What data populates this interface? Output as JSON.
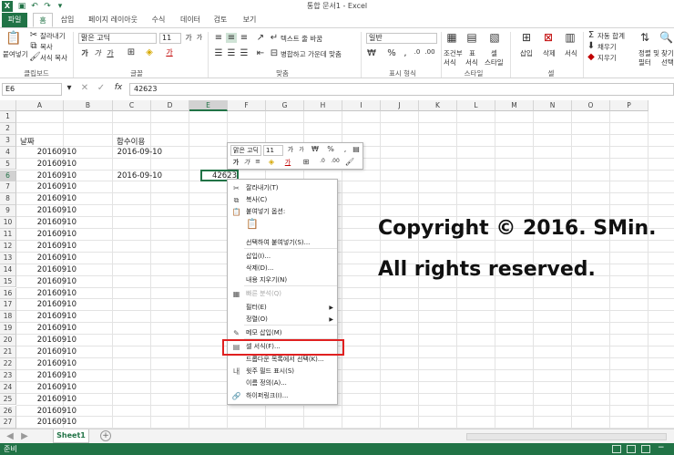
{
  "window": {
    "title": "통합 문서1 - Excel"
  },
  "ribbon_tabs": [
    "파일",
    "홈",
    "삽입",
    "페이지 레이아웃",
    "수식",
    "데이터",
    "검토",
    "보기"
  ],
  "ribbon": {
    "clipboard": {
      "paste": "붙여넣기",
      "cut": "잘라내기",
      "copy": "복사",
      "format_painter": "서식 복사",
      "label": "클립보드"
    },
    "font": {
      "name": "맑은 고딕",
      "size": "11",
      "label": "글꼴"
    },
    "alignment": {
      "wrap": "텍스트 줄 바꿈",
      "merge": "병합하고 가운데 맞춤",
      "label": "맞춤"
    },
    "number": {
      "format": "일반",
      "label": "표시 형식"
    },
    "styles": {
      "conditional": "조건부",
      "conditional2": "서식",
      "table": "표",
      "table2": "서식",
      "cell": "셀",
      "cell2": "스타일",
      "label": "스타일"
    },
    "cells": {
      "insert": "삽입",
      "delete": "삭제",
      "format": "서식",
      "label": "셀"
    },
    "editing": {
      "autosum": "자동 합계",
      "fill": "채우기",
      "clear": "지우기",
      "sort": "정렬 및",
      "sort2": "필터",
      "find": "찾기",
      "find2": "선택"
    }
  },
  "formula_bar": {
    "name_box": "E6",
    "formula": "42623"
  },
  "columns": [
    "A",
    "B",
    "C",
    "D",
    "E",
    "F",
    "G",
    "H",
    "I",
    "J",
    "K",
    "L",
    "M",
    "N",
    "O",
    "P"
  ],
  "rows": [
    "1",
    "2",
    "3",
    "4",
    "5",
    "6",
    "7",
    "8",
    "9",
    "10",
    "11",
    "12",
    "13",
    "14",
    "15",
    "16",
    "17",
    "18",
    "19",
    "20",
    "21",
    "22",
    "23",
    "24",
    "25",
    "26",
    "27"
  ],
  "cells": {
    "A3": "날짜",
    "C3": "함수이용",
    "A_values": [
      "20160910",
      "20160910",
      "20160910",
      "20160910",
      "20160910",
      "20160910",
      "20160910",
      "20160910",
      "20160910",
      "20160910",
      "20160910",
      "20160910",
      "20160910",
      "20160910",
      "20160910",
      "20160910",
      "20160910",
      "20160910",
      "20160910",
      "20160910",
      "20160910",
      "20160910",
      "20160910",
      "20160910"
    ],
    "C4": "2016-09-10",
    "C6": "2016-09-10",
    "E6": "42623"
  },
  "mini_toolbar": {
    "font": "맑은 고딕",
    "size": "11",
    "percent": "%"
  },
  "context_menu": [
    {
      "label": "잘라내기(T)",
      "icon": "scissors-icon"
    },
    {
      "label": "복사(C)",
      "icon": "copy-icon"
    },
    {
      "label": "붙여넣기 옵션:",
      "icon": "paste-icon"
    },
    {
      "label": "",
      "icon": "clipboard-icon"
    },
    {
      "label": "선택하여 붙여넣기(S)...",
      "icon": ""
    },
    {
      "label": "삽입(I)...",
      "icon": ""
    },
    {
      "label": "삭제(D)...",
      "icon": ""
    },
    {
      "label": "내용 지우기(N)",
      "icon": ""
    },
    {
      "label": "빠른 분석(Q)",
      "icon": "quick-analysis-icon"
    },
    {
      "label": "필터(E)",
      "icon": ""
    },
    {
      "label": "정렬(O)",
      "icon": ""
    },
    {
      "label": "메모 삽입(M)",
      "icon": "comment-icon"
    },
    {
      "label": "셀 서식(F)...",
      "icon": "format-cells-icon"
    },
    {
      "label": "드롭다운 목록에서 선택(K)...",
      "icon": ""
    },
    {
      "label": "윗주 필드 표시(S)",
      "icon": "phonetic-icon"
    },
    {
      "label": "이름 정의(A)...",
      "icon": ""
    },
    {
      "label": "하이퍼링크(I)...",
      "icon": "hyperlink-icon"
    }
  ],
  "overlay": {
    "line1": "Copyright © 2016. SMin.",
    "line2": "All rights reserved."
  },
  "sheet_tab": "Sheet1",
  "status": {
    "ready": "준비"
  },
  "colors": {
    "accent": "#217346",
    "highlight": "#e02020"
  }
}
